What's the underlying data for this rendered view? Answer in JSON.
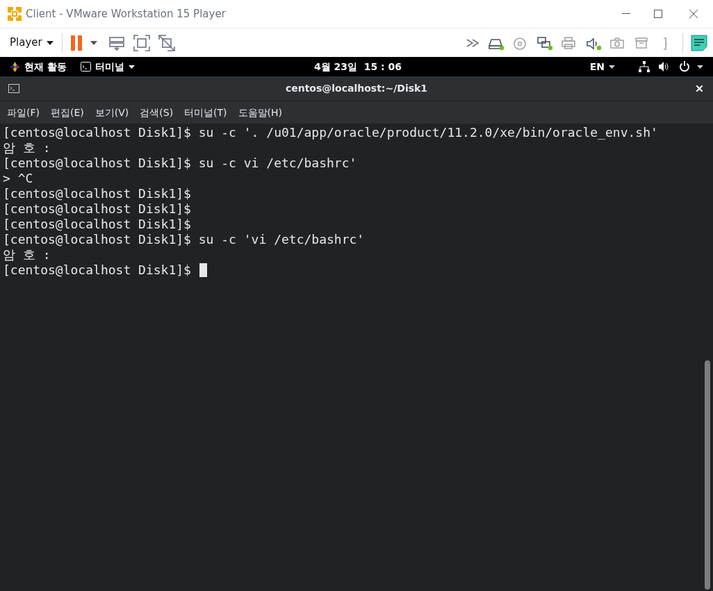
{
  "window": {
    "title": "Client - VMware Workstation 15 Player"
  },
  "toolbar": {
    "player_menu": "Player",
    "paused": true
  },
  "devices": [
    {
      "kind": "disk",
      "connected": true
    },
    {
      "kind": "cd",
      "connected": false
    },
    {
      "kind": "network",
      "connected": true
    },
    {
      "kind": "printer",
      "connected": false
    },
    {
      "kind": "sound",
      "connected": true
    },
    {
      "kind": "camera",
      "connected": false
    },
    {
      "kind": "usb",
      "connected": false
    },
    {
      "kind": "bracket",
      "connected": false
    }
  ],
  "top_bar": {
    "activities": "현재 활동",
    "app_menu": "터미널",
    "clock": "4월 23일  15 : 06",
    "language": "EN"
  },
  "terminal": {
    "title": "centos@localhost:~/Disk1",
    "menu": [
      "파일(F)",
      "편집(E)",
      "보기(V)",
      "검색(S)",
      "터미널(T)",
      "도움말(H)"
    ],
    "lines": [
      "[centos@localhost Disk1]$ su -c '. /u01/app/oracle/product/11.2.0/xe/bin/oracle_env.sh'",
      "암 호 :",
      "[centos@localhost Disk1]$ su -c vi /etc/bashrc'",
      "> ^C",
      "[centos@localhost Disk1]$",
      "[centos@localhost Disk1]$",
      "[centos@localhost Disk1]$",
      "[centos@localhost Disk1]$ su -c 'vi /etc/bashrc'",
      "암 호 :",
      "[centos@localhost Disk1]$ "
    ],
    "cursor_visible": true
  }
}
